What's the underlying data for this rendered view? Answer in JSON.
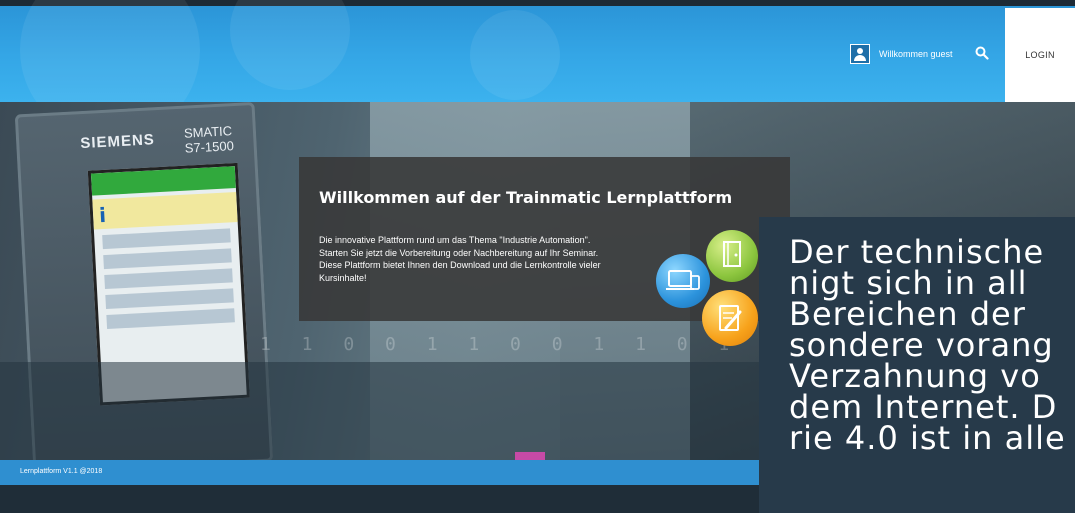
{
  "header": {
    "welcome": "Willkommen guest",
    "login_label": "LOGIN",
    "icons": {
      "user": "user-icon",
      "search": "search-icon"
    }
  },
  "hero": {
    "plc_brand": "SIEMENS",
    "plc_model": "SMATIC\nS7-1500",
    "binary_text": "1 1 0 0 1 1 0 0 1 1 0 1 1"
  },
  "welcome_panel": {
    "title": "Willkommen auf der Trainmatic Lernplattform",
    "text": "Die innovative Plattform rund um das Thema \"Industrie Automation\".\n Starten Sie jetzt die Vorbereitung oder Nachbereitung auf Ihr Seminar.\nDiese Plattform bietet Ihnen den Download  und die Lernkontrolle vieler Kursinhalte!",
    "icons": [
      "devices-icon",
      "document-icon",
      "edit-icon"
    ]
  },
  "overlay": {
    "text": "Der technische\nnigt sich in all\nBereichen der\nsondere vorang\nVerzahnung vo\ndem Internet. D\nrie 4.0 ist in alle"
  },
  "footer": {
    "text": "Lernplattform V1.1 @2018"
  },
  "colors": {
    "header_blue": "#34a6e6",
    "footer_blue": "#2f8fd0",
    "panel_bg": "#383838",
    "overlay_bg": "#273a4a"
  }
}
